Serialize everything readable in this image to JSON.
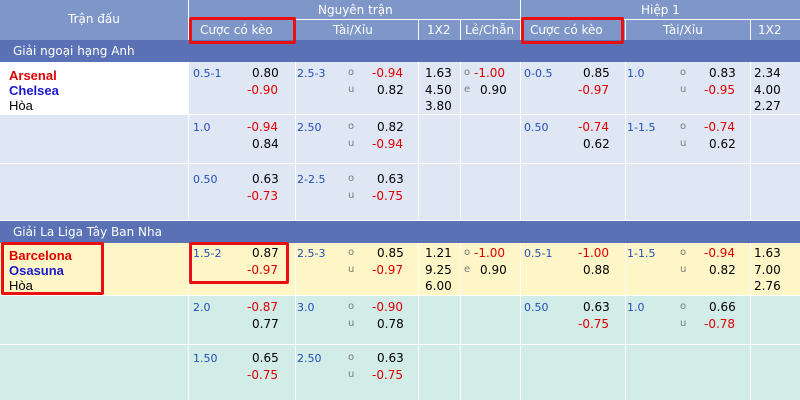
{
  "header": {
    "match_col": "Trận đấu",
    "full_time": "Nguyên trận",
    "first_half": "Hiệp 1",
    "handicap": "Cược có kèo",
    "over_under": "Tài/Xỉu",
    "x12": "1X2",
    "odd_even": "Lẻ/Chẵn"
  },
  "ou_labels": {
    "over": "o",
    "under": "u",
    "even": "e"
  },
  "leagues": [
    {
      "name": "Giải ngoại hạng Anh",
      "home": "Arsenal",
      "away": "Chelsea",
      "draw": "Hòa",
      "rows": [
        {
          "ft_hdp": "0.5-1",
          "ft_hdp_h": "0.80",
          "ft_hdp_a": "-0.90",
          "ft_ou": "2.5-3",
          "ft_ou_o": "-0.94",
          "ft_ou_u": "0.82",
          "ft_1": "1.63",
          "ft_2": "4.50",
          "ft_x": "3.80",
          "oe_o": "-1.00",
          "oe_e": "0.90",
          "h1_hdp": "0-0.5",
          "h1_hdp_h": "0.85",
          "h1_hdp_a": "-0.97",
          "h1_ou": "1.0",
          "h1_ou_o": "0.83",
          "h1_ou_u": "-0.95",
          "h1_1": "2.34",
          "h1_2": "4.00",
          "h1_x": "2.27"
        },
        {
          "ft_hdp": "1.0",
          "ft_hdp_h": "-0.94",
          "ft_hdp_a": "0.84",
          "ft_ou": "2.50",
          "ft_ou_o": "0.82",
          "ft_ou_u": "-0.94",
          "h1_hdp": "0.50",
          "h1_hdp_h": "-0.74",
          "h1_hdp_a": "0.62",
          "h1_ou": "1-1.5",
          "h1_ou_o": "-0.74",
          "h1_ou_u": "0.62"
        },
        {
          "ft_hdp": "0.50",
          "ft_hdp_h": "0.63",
          "ft_hdp_a": "-0.73",
          "ft_ou": "2-2.5",
          "ft_ou_o": "0.63",
          "ft_ou_u": "-0.75"
        }
      ]
    },
    {
      "name": "Giải La Liga Tây Ban Nha",
      "home": "Barcelona",
      "away": "Osasuna",
      "draw": "Hòa",
      "rows": [
        {
          "ft_hdp": "1.5-2",
          "ft_hdp_h": "0.87",
          "ft_hdp_a": "-0.97",
          "ft_ou": "2.5-3",
          "ft_ou_o": "0.85",
          "ft_ou_u": "-0.97",
          "ft_1": "1.21",
          "ft_2": "9.25",
          "ft_x": "6.00",
          "oe_o": "-1.00",
          "oe_e": "0.90",
          "h1_hdp": "0.5-1",
          "h1_hdp_h": "-1.00",
          "h1_hdp_a": "0.88",
          "h1_ou": "1-1.5",
          "h1_ou_o": "-0.94",
          "h1_ou_u": "0.82",
          "h1_1": "1.63",
          "h1_2": "7.00",
          "h1_x": "2.76"
        },
        {
          "ft_hdp": "2.0",
          "ft_hdp_h": "-0.87",
          "ft_hdp_a": "0.77",
          "ft_ou": "3.0",
          "ft_ou_o": "-0.90",
          "ft_ou_u": "0.78",
          "h1_hdp": "0.50",
          "h1_hdp_h": "0.63",
          "h1_hdp_a": "-0.75",
          "h1_ou": "1.0",
          "h1_ou_o": "0.66",
          "h1_ou_u": "-0.78"
        },
        {
          "ft_hdp": "1.50",
          "ft_hdp_h": "0.65",
          "ft_hdp_a": "-0.75",
          "ft_ou": "2.50",
          "ft_ou_o": "0.63",
          "ft_ou_u": "-0.75"
        }
      ]
    }
  ],
  "colors": {
    "header_bg": "#7e96c8",
    "league_bg": "#5a72b5",
    "row_blue": "#dfe6f4",
    "row_highlight": "#fff6c8",
    "row_teal": "#d2ece8",
    "negative": "#e00000",
    "highlight_box": "#e81010"
  }
}
